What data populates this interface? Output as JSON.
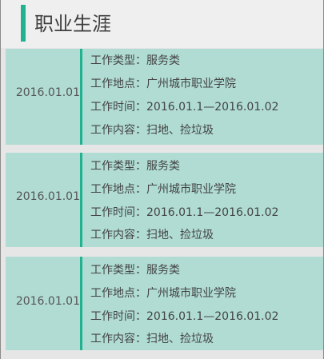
{
  "page_title": "职业生涯",
  "colors": {
    "accent": "#21b28f",
    "card_bg": "#b0dcd3",
    "page_bg": "#e6e6e6"
  },
  "entries": [
    {
      "date": "2016.01.01",
      "lines": [
        "工作类型：服务类",
        "工作地点：广州城市职业学院",
        "工作时间：2016.01.1—2016.01.02",
        "工作内容：扫地、捡垃圾"
      ]
    },
    {
      "date": "2016.01.01",
      "lines": [
        "工作类型：服务类",
        "工作地点：广州城市职业学院",
        "工作时间：2016.01.1—2016.01.02",
        "工作内容：扫地、捡垃圾"
      ]
    },
    {
      "date": "2016.01.01",
      "lines": [
        "工作类型：服务类",
        "工作地点：广州城市职业学院",
        "工作时间：2016.01.1—2016.01.02",
        "工作内容：扫地、捡垃圾"
      ]
    }
  ]
}
